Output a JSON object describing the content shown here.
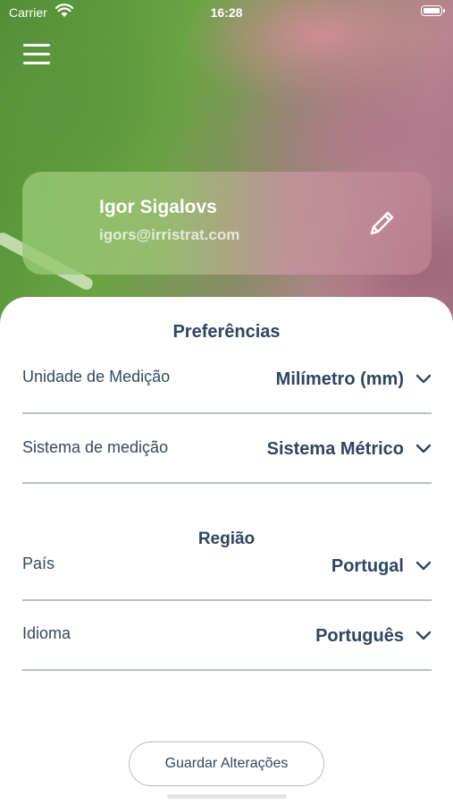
{
  "status_bar": {
    "carrier": "Carrier",
    "time": "16:28"
  },
  "profile": {
    "name": "Igor Sigalovs",
    "email": "igors@irristrat.com"
  },
  "preferences": {
    "title": "Preferências",
    "rows": [
      {
        "label": "Unidade de Medição",
        "value": "Milímetro (mm)"
      },
      {
        "label": "Sistema de medição",
        "value": "Sistema Métrico"
      }
    ]
  },
  "region": {
    "title": "Região",
    "rows": [
      {
        "label": "País",
        "value": "Portugal"
      },
      {
        "label": "Idioma",
        "value": "Português"
      }
    ]
  },
  "actions": {
    "save_label": "Guardar Alterações"
  },
  "colors": {
    "text_primary": "#2f4560",
    "divider": "#b7bfc7",
    "hero_green": "#5c963e",
    "hero_pink": "#b2788c"
  },
  "icons": [
    "wifi-icon",
    "battery-icon",
    "hamburger-menu-icon",
    "pencil-icon",
    "chevron-down-icon"
  ]
}
